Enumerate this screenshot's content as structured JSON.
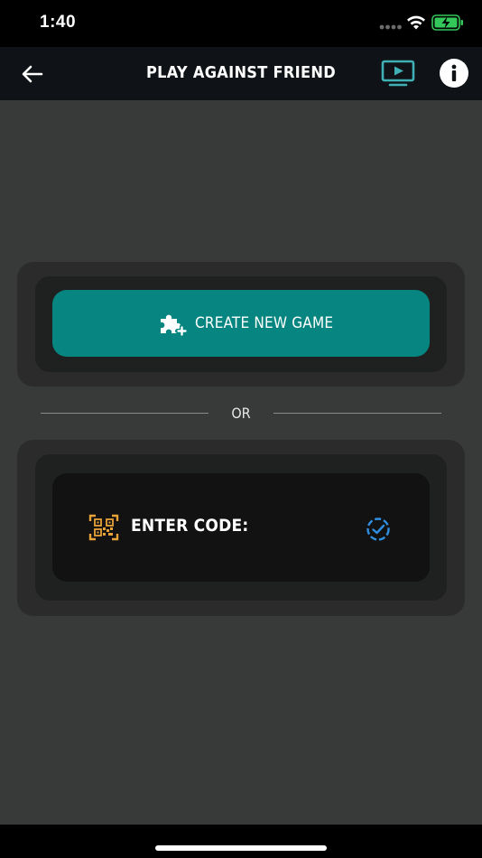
{
  "status_bar": {
    "time": "1:40"
  },
  "nav": {
    "title": "PLAY AGAINST FRIEND",
    "back_icon": "arrow-left-icon",
    "cast_icon": "cast-screen-icon",
    "info_icon": "info-icon"
  },
  "create_game": {
    "label": "CREATE NEW GAME",
    "icon": "puzzle-plus-icon"
  },
  "divider": {
    "label": "OR"
  },
  "enter_code": {
    "label": "ENTER CODE:",
    "icon": "qr-code-icon",
    "confirm_icon": "check-circle-dashed-icon",
    "value": ""
  },
  "colors": {
    "background": "#383939",
    "nav_bar": "#0f1216",
    "accent_teal": "#078580",
    "cast_icon": "#3fb0b6",
    "qr_icon": "#e8a238",
    "confirm_icon": "#2f8fe0"
  }
}
